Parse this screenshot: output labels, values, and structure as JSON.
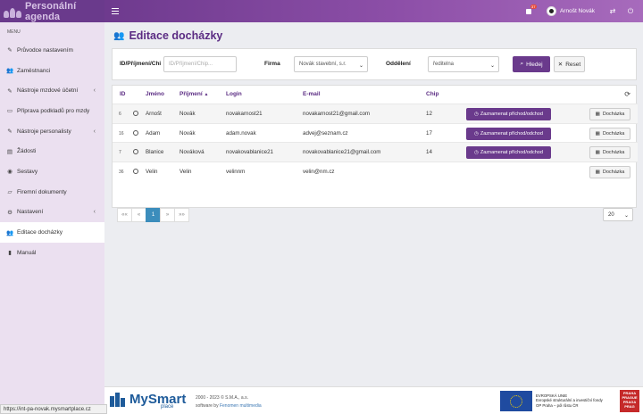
{
  "app": {
    "title": "Personální agenda"
  },
  "topbar": {
    "notification_count": "37",
    "user_name": "Arnošt Novák"
  },
  "sidebar": {
    "menu_label": "MENU",
    "items": [
      {
        "label": "Průvodce nastavením",
        "icon": "wrench-icon",
        "chevron": false
      },
      {
        "label": "Zaměstnanci",
        "icon": "users-icon",
        "chevron": false
      },
      {
        "label": "Nástroje mzdové účetní",
        "icon": "wrench-icon",
        "chevron": true
      },
      {
        "label": "Příprava podkladů pro mzdy",
        "icon": "card-icon",
        "chevron": false
      },
      {
        "label": "Nástroje personalisty",
        "icon": "wrench-icon",
        "chevron": true
      },
      {
        "label": "Žádosti",
        "icon": "file-icon",
        "chevron": false
      },
      {
        "label": "Sestavy",
        "icon": "eye-icon",
        "chevron": false
      },
      {
        "label": "Firemní dokumenty",
        "icon": "folder-icon",
        "chevron": false
      },
      {
        "label": "Nastavení",
        "icon": "gears-icon",
        "chevron": true
      },
      {
        "label": "Editace docházky",
        "icon": "users-icon",
        "chevron": false,
        "active": true
      },
      {
        "label": "Manuál",
        "icon": "book-icon",
        "chevron": false
      }
    ]
  },
  "page": {
    "title": "Editace docházky"
  },
  "filters": {
    "id_label": "ID/Příjmení/Chi",
    "id_placeholder": "ID/Příjmení/Chip...",
    "firma_label": "Firma",
    "firma_value": "Novák stavební, s.r.",
    "oddeleni_label": "Oddělení",
    "oddeleni_value": "ředitelna",
    "search_button": "Hledej",
    "reset_button": "Reset"
  },
  "table": {
    "headers": {
      "id": "ID",
      "jmeno": "Jméno",
      "prijmeni": "Příjmení",
      "login": "Login",
      "email": "E-mail",
      "chip": "Chip"
    },
    "record_button": "Zaznamenat příchod/odchod",
    "attendance_button": "Docházka",
    "rows": [
      {
        "id": "6",
        "jmeno": "Arnošt",
        "prijmeni": "Novák",
        "login": "novakarnost21",
        "email": "novakarnost21@gmail.com",
        "chip": "12",
        "has_record": true
      },
      {
        "id": "16",
        "jmeno": "Adam",
        "prijmeni": "Novák",
        "login": "adam.novak",
        "email": "advej@seznam.cz",
        "chip": "17",
        "has_record": true
      },
      {
        "id": "7",
        "jmeno": "Blanice",
        "prijmeni": "Nováková",
        "login": "novakovablanice21",
        "email": "novakovablanice21@gmail.com",
        "chip": "14",
        "has_record": true
      },
      {
        "id": "36",
        "jmeno": "Velin",
        "prijmeni": "Velin",
        "login": "velinnm",
        "email": "velin@nm.cz",
        "chip": "",
        "has_record": false
      }
    ]
  },
  "pagination": {
    "first": "««",
    "prev": "«",
    "current": "1",
    "next": "»",
    "last": "»»",
    "per_page": "20"
  },
  "footer": {
    "brand": "MySmart",
    "brand_sub": "place",
    "copyright": "2000 - 2023 © S.M.A., a.s.",
    "software_by_prefix": "software by",
    "software_by_link": "Fenomen multimedia",
    "eu_line1": "EVROPSKÁ UNIE",
    "eu_line2": "Evropské strukturální a investiční fondy",
    "eu_line3": "OP Praha – pól růstu ČR",
    "prague_text": "PRAHA PRAGUE PRAGA PRAG"
  },
  "status_bar": {
    "url": "https://int-pa-novak.mysmartplace.cz"
  }
}
